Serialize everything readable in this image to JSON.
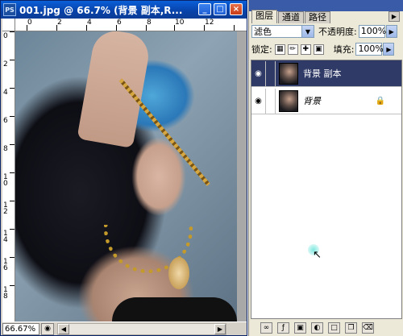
{
  "document": {
    "title": "001.jpg @ 66.7% (背景 副本,R...",
    "icon_label": "PS",
    "window_buttons": {
      "minimize": "_",
      "maximize": "□",
      "close": "×"
    },
    "ruler_top_labels": [
      "0",
      "2",
      "4",
      "6",
      "8",
      "10",
      "12"
    ],
    "ruler_left_labels": [
      "0",
      "2",
      "4",
      "6",
      "8",
      "10",
      "12",
      "14",
      "16",
      "18"
    ],
    "status": {
      "zoom": "66.67%"
    }
  },
  "layers_panel": {
    "tabs": [
      "图层",
      "通道",
      "路径"
    ],
    "active_tab": "图层",
    "blend_mode": "滤色",
    "opacity_label": "不透明度:",
    "opacity_value": "100%",
    "lock_label": "锁定:",
    "fill_label": "填充:",
    "fill_value": "100%",
    "layers": [
      {
        "name": "背景 副本",
        "selected": true,
        "locked": false,
        "italic": false
      },
      {
        "name": "背景",
        "selected": false,
        "locked": true,
        "italic": true
      }
    ],
    "footer_icons": [
      "link-icon",
      "effects-icon",
      "mask-icon",
      "adjustment-icon",
      "group-icon",
      "new-layer-icon",
      "trash-icon"
    ]
  },
  "colors": {
    "titlebar": "#0a5fd8",
    "panel_bg": "#ece9d8",
    "selected_layer": "#2f3a66"
  }
}
